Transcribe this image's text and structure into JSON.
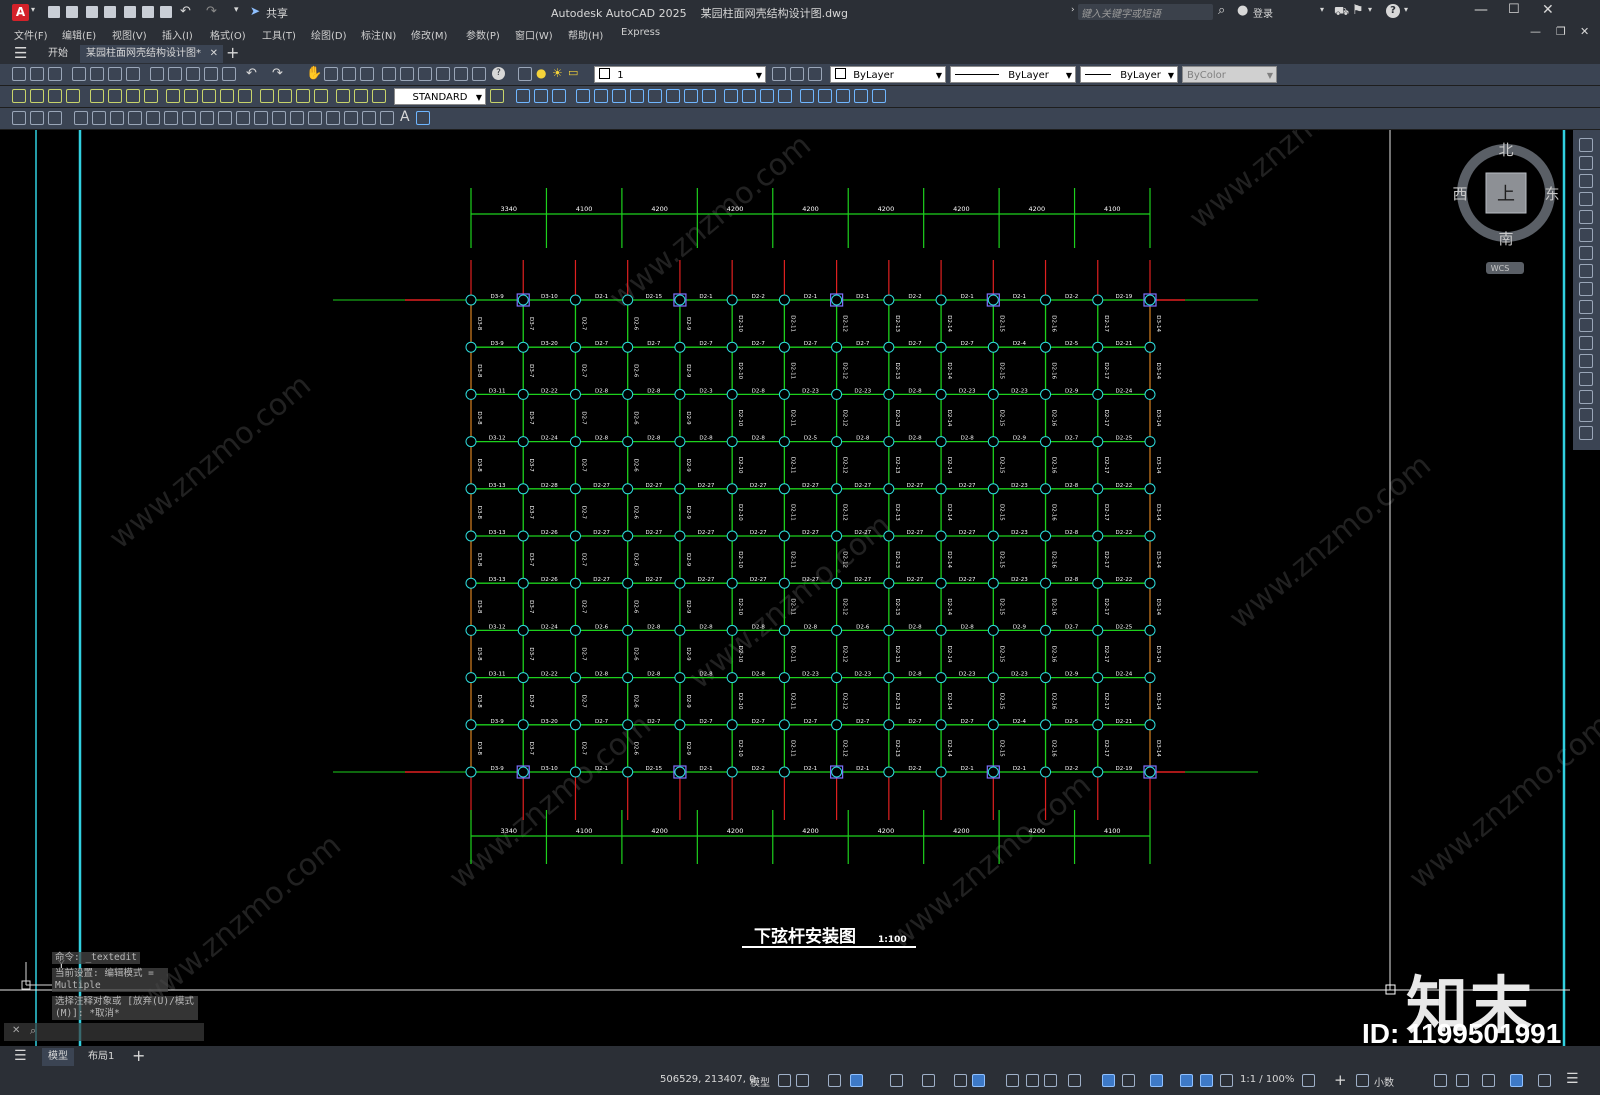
{
  "window": {
    "title": "Autodesk AutoCAD 2025    某园柱面网壳结构设计图.dwg",
    "share_label": "共享",
    "search_placeholder": "键入关键字或短语",
    "login_label": "登录"
  },
  "menu": [
    "文件(F)",
    "编辑(E)",
    "视图(V)",
    "插入(I)",
    "格式(O)",
    "工具(T)",
    "绘图(D)",
    "标注(N)",
    "修改(M)",
    "参数(P)",
    "窗口(W)",
    "帮助(H)",
    "Express"
  ],
  "doc_tabs": {
    "start": "开始",
    "active": "某园柱面网壳结构设计图*"
  },
  "toolbar": {
    "layer_value": "1",
    "color_value": "ByLayer",
    "linetype_value": "ByLayer",
    "lineweight_value": "ByLayer",
    "plotstyle_value": "ByColor",
    "dimstyle_value": "STANDARD"
  },
  "drawing": {
    "title": "下弦杆安装图",
    "scale": "1:100",
    "dims": [
      "3340",
      "4100",
      "4200",
      "4200",
      "4200",
      "4200",
      "4200",
      "4200",
      "4100"
    ],
    "row_labels": [
      [
        "D3-9",
        "D3-10",
        "D2-1",
        "D2-15",
        "D2-1",
        "D2-2",
        "D2-1",
        "D2-1",
        "D2-2",
        "D2-1",
        "D2-1",
        "D2-2",
        "D2-19"
      ],
      [
        "D3-9",
        "D3-20",
        "D2-7",
        "D2-7",
        "D2-7",
        "D2-7",
        "D2-7",
        "D2-7",
        "D2-7",
        "D2-7",
        "D2-4",
        "D2-5",
        "D2-21"
      ],
      [
        "D3-11",
        "D2-22",
        "D2-8",
        "D2-8",
        "D2-3",
        "D2-8",
        "D2-23",
        "D2-23",
        "D2-8",
        "D2-23",
        "D2-23",
        "D2-9",
        "D2-24"
      ],
      [
        "D3-12",
        "D2-24",
        "D2-8",
        "D2-8",
        "D2-8",
        "D2-8",
        "D2-5",
        "D2-8",
        "D2-8",
        "D2-8",
        "D2-9",
        "D2-7",
        "D2-25"
      ],
      [
        "D3-13",
        "D2-28",
        "D2-27",
        "D2-27",
        "D2-27",
        "D2-27",
        "D2-27",
        "D2-27",
        "D2-27",
        "D2-27",
        "D2-23",
        "D2-8",
        "D2-22"
      ],
      [
        "D3-13",
        "D2-26",
        "D2-27",
        "D2-27",
        "D2-27",
        "D2-27",
        "D2-27",
        "D2-27",
        "D2-27",
        "D2-27",
        "D2-23",
        "D2-8",
        "D2-22"
      ],
      [
        "D3-13",
        "D2-26",
        "D2-27",
        "D2-27",
        "D2-27",
        "D2-27",
        "D2-27",
        "D2-27",
        "D2-27",
        "D2-27",
        "D2-23",
        "D2-8",
        "D2-22"
      ],
      [
        "D3-12",
        "D2-24",
        "D2-6",
        "D2-8",
        "D2-8",
        "D2-8",
        "D2-8",
        "D2-6",
        "D2-8",
        "D2-8",
        "D2-9",
        "D2-7",
        "D2-25"
      ],
      [
        "D3-11",
        "D2-22",
        "D2-8",
        "D2-8",
        "D2-8",
        "D2-8",
        "D2-23",
        "D2-23",
        "D2-8",
        "D2-23",
        "D2-23",
        "D2-9",
        "D2-24"
      ],
      [
        "D3-9",
        "D3-20",
        "D2-7",
        "D2-7",
        "D2-7",
        "D2-7",
        "D2-7",
        "D2-7",
        "D2-7",
        "D2-7",
        "D2-4",
        "D2-5",
        "D2-21"
      ],
      [
        "D3-9",
        "D3-10",
        "D2-1",
        "D2-15",
        "D2-1",
        "D2-2",
        "D2-1",
        "D2-1",
        "D2-2",
        "D2-1",
        "D2-1",
        "D2-2",
        "D2-19"
      ]
    ],
    "col_labels": [
      "D3-8",
      "D3-7",
      "D2-7",
      "D2-6",
      "D2-9",
      "D2-10",
      "D2-11",
      "D2-12",
      "D2-13",
      "D2-14",
      "D2-15",
      "D2-16",
      "D2-17",
      "D3-14"
    ]
  },
  "viewcube": {
    "north": "北",
    "south": "南",
    "east": "东",
    "west": "西",
    "face": "上",
    "wcs": "WCS"
  },
  "command": {
    "line1": "命令: _textedit",
    "line2": "当前设置: 编辑模式 = Multiple",
    "line3": "选择注释对象或 [放弃(U)/模式(M)]: *取消*"
  },
  "layout_tabs": {
    "model": "模型",
    "layout1": "布局1"
  },
  "status": {
    "coords": "506529, 213407, 0",
    "space": "模型",
    "scale": "1:1 / 100%",
    "units": "小数"
  },
  "watermark": {
    "logo": "知末",
    "id": "ID: 1199501991",
    "site": "www.znzmo.com"
  }
}
